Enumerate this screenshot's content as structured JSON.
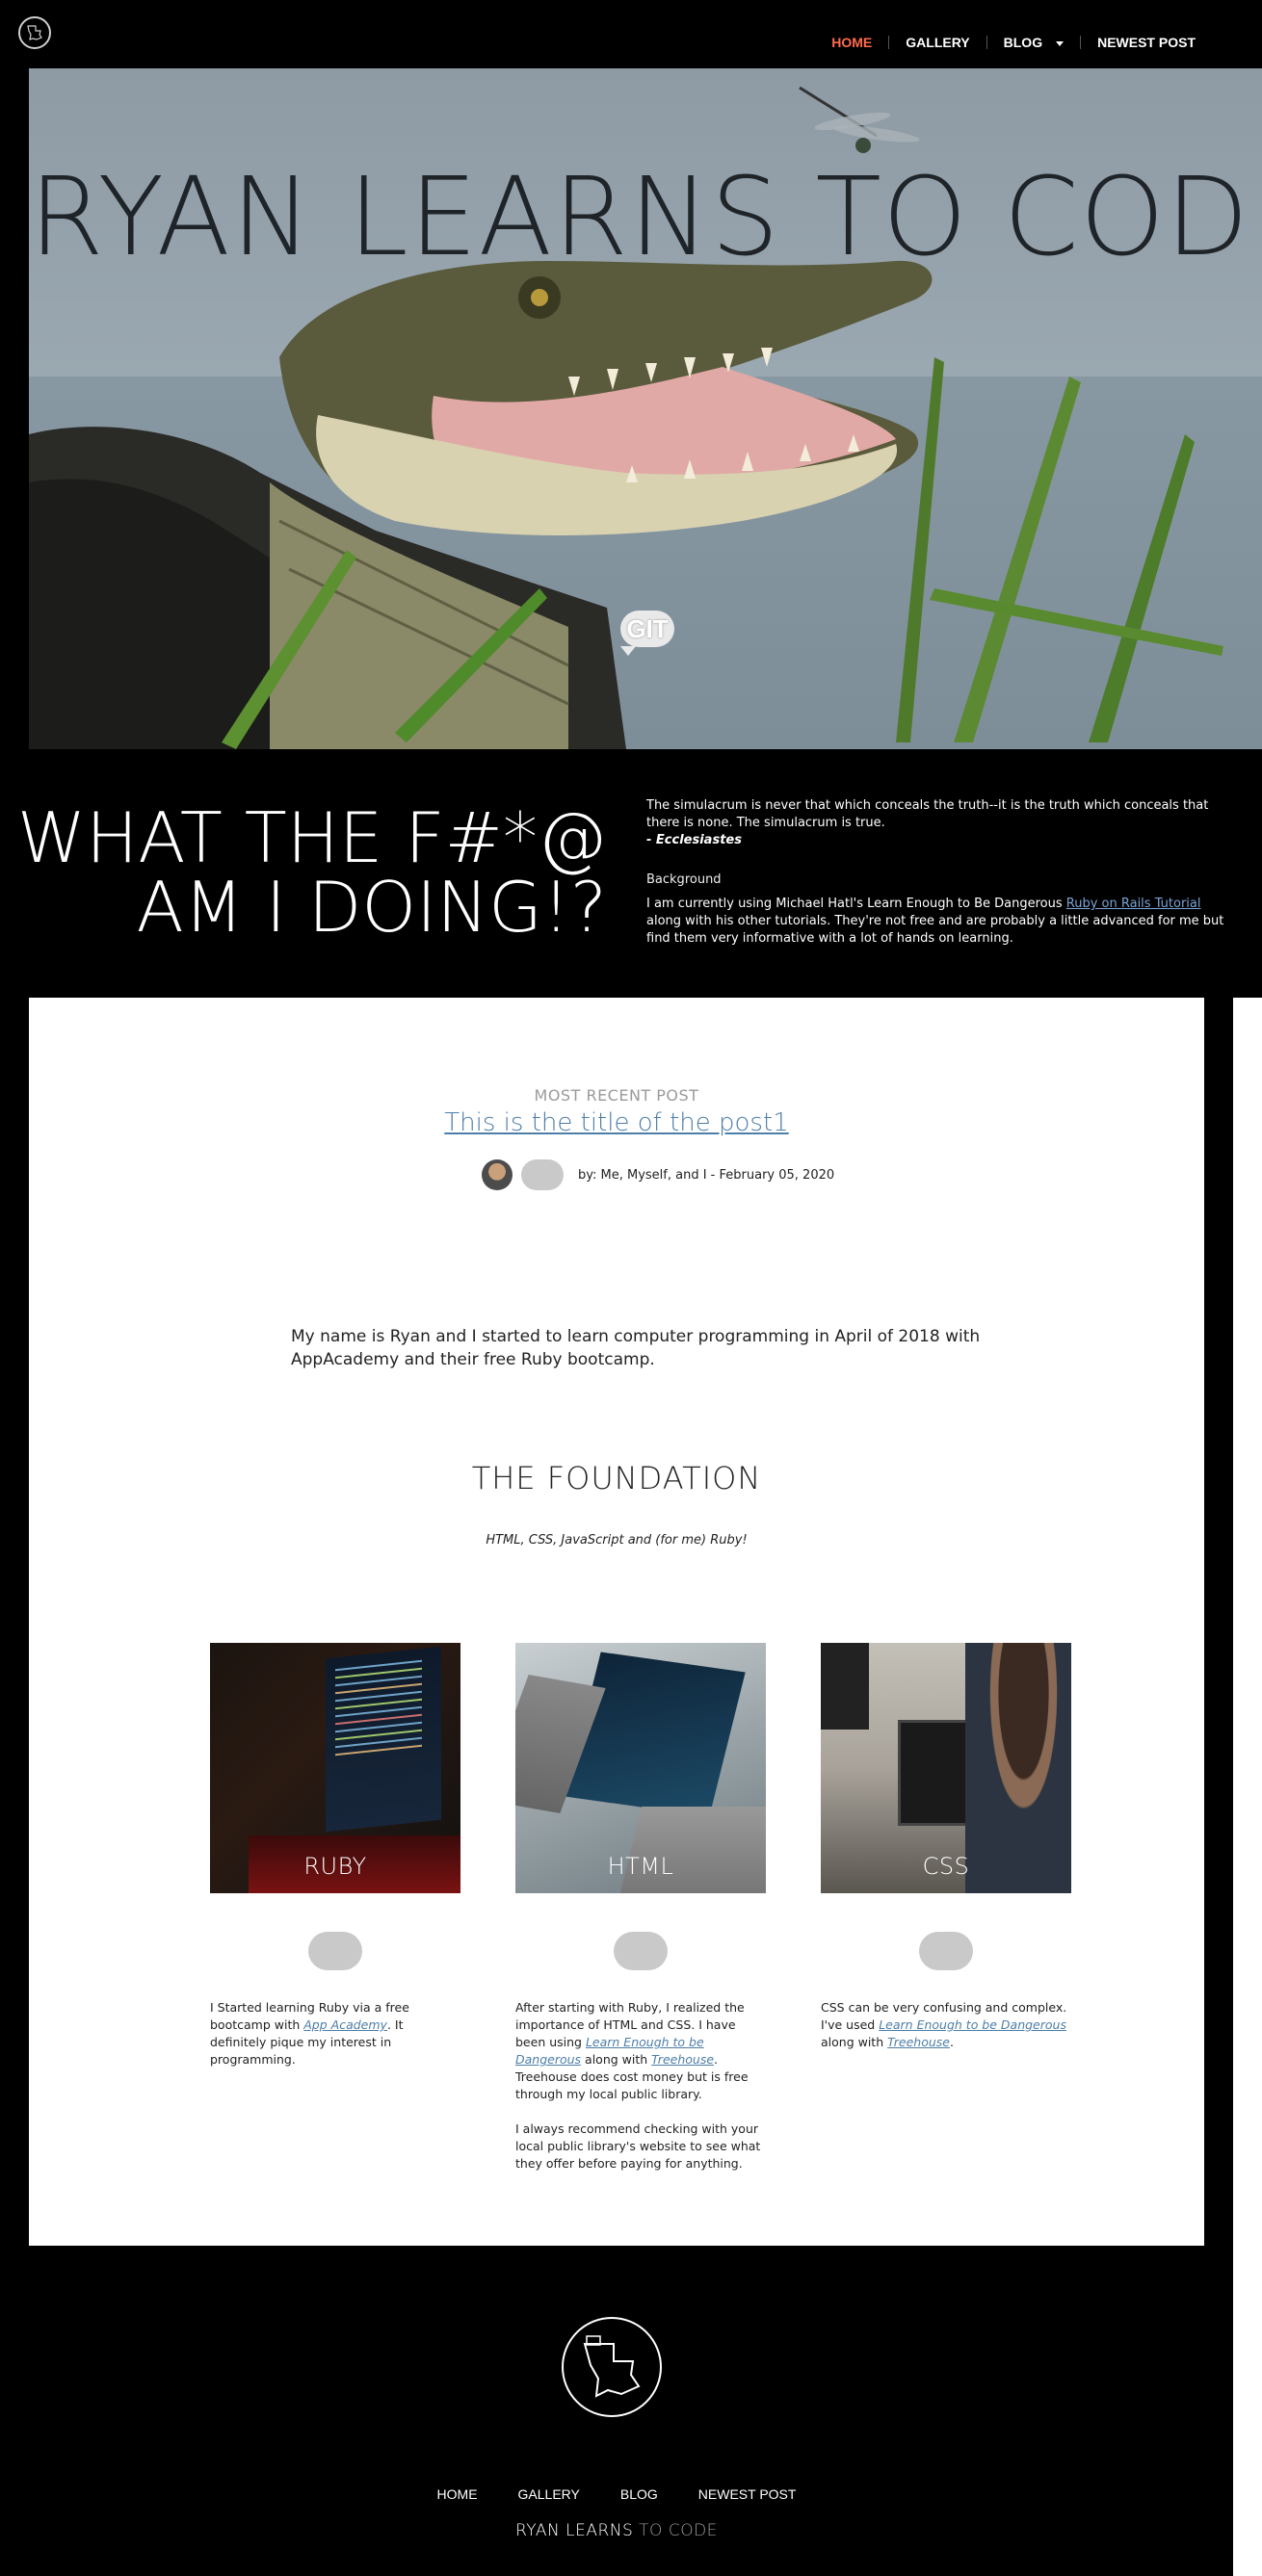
{
  "nav": {
    "items": [
      {
        "label": "HOME"
      },
      {
        "label": "GALLERY"
      },
      {
        "label": "BLOG"
      },
      {
        "label": "NEWEST POST"
      }
    ]
  },
  "hero": {
    "title": "RYAN LEARNS TO CODE",
    "badge": "GIT"
  },
  "banner": {
    "heading_line1": "WHAT THE F#*@",
    "heading_line2": "AM I DOING!?",
    "quote": "The simulacrum is never that which conceals the truth--it is the truth which conceals that there is none. The simulacrum is true.",
    "quote_attribution": "- Ecclesiastes",
    "background_label": "Background",
    "background_pre": "I am currently using Michael Hatl's Learn Enough to Be Dangerous ",
    "background_link": "Ruby on Rails Tutorial",
    "background_post": " along with his other tutorials. They're not free and are probably a little advanced for me but find them very informative with a lot of hands on learning."
  },
  "post": {
    "section_label": "MOST RECENT POST",
    "title": "This is the title of the post1",
    "byline": "by: Me, Myself, and I - February 05, 2020"
  },
  "intro": "My name is Ryan and I started to learn computer programming in April of 2018 with AppAcademy and their free Ruby bootcamp.",
  "foundation": {
    "title": "THE FOUNDATION",
    "subtitle": "HTML, CSS, JavaScript and (for me) Ruby!"
  },
  "cards": {
    "ruby": {
      "label": "RUBY",
      "t1": "I Started learning Ruby via a free bootcamp with ",
      "l1": "App Academy",
      "t2": ". It definitely pique my interest in programming."
    },
    "html": {
      "label": "HTML",
      "t1": "After starting with Ruby, I realized the importance of HTML and CSS. I have been using ",
      "l1": "Learn Enough to be Dangerous",
      "t2": " along with ",
      "l2": "Treehouse",
      "t3": ". Treehouse does cost money but is free through my local public library.",
      "p2": "I always recommend checking with your local public library's website to see what they offer before paying for anything."
    },
    "css": {
      "label": "CSS",
      "t1": "CSS can be very confusing and complex. I've used ",
      "l1": "Learn Enough to be Dangerous",
      "t2": " along with ",
      "l2": "Treehouse",
      "t3": "."
    }
  },
  "footer": {
    "nav": [
      "HOME",
      "GALLERY",
      "BLOG",
      "NEWEST POST"
    ],
    "brand_main": "RYAN LEARNS",
    "brand_dim": " TO CODE"
  },
  "colors": {
    "active_nav": "#ff6a4d",
    "link": "#4d7ea8",
    "background": "#000000"
  }
}
